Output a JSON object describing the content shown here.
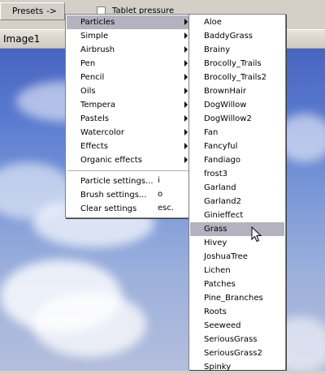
{
  "toolbar": {
    "presets_label": "Presets",
    "presets_arrow": "->",
    "tablet_label": "Tablet pressure"
  },
  "image_window": {
    "title": "Image1"
  },
  "main_menu": {
    "items": [
      {
        "label": "Particles",
        "submenu": true
      },
      {
        "label": "Simple",
        "submenu": true
      },
      {
        "label": "Airbrush",
        "submenu": true
      },
      {
        "label": "Pen",
        "submenu": true
      },
      {
        "label": "Pencil",
        "submenu": true
      },
      {
        "label": "Oils",
        "submenu": true
      },
      {
        "label": "Tempera",
        "submenu": true
      },
      {
        "label": "Pastels",
        "submenu": true
      },
      {
        "label": "Watercolor",
        "submenu": true
      },
      {
        "label": "Effects",
        "submenu": true
      },
      {
        "label": "Organic effects",
        "submenu": true
      }
    ],
    "actions": [
      {
        "label": "Particle settings...",
        "shortcut": "i"
      },
      {
        "label": "Brush settings...",
        "shortcut": "o"
      },
      {
        "label": "Clear settings",
        "shortcut": "esc."
      }
    ]
  },
  "particles_menu": {
    "items": [
      "Aloe",
      "BaddyGrass",
      "Brainy",
      "Brocolly_Trails",
      "Brocolly_Trails2",
      "BrownHair",
      "DogWillow",
      "DogWillow2",
      "Fan",
      "Fancyful",
      "Fandiago",
      "frost3",
      "Garland",
      "Garland2",
      "Ginieffect",
      "Grass",
      "Hivey",
      "JoshuaTree",
      "Lichen",
      "Patches",
      "Pine_Branches",
      "Roots",
      "Seeweed",
      "SeriousGrass",
      "SeriousGrass2",
      "Spinky"
    ],
    "highlighted": "Grass"
  },
  "colors": {
    "menu_highlight": "#b5b2c0",
    "sky_top": "#4864c0",
    "sky_bottom": "#b4bedc"
  }
}
